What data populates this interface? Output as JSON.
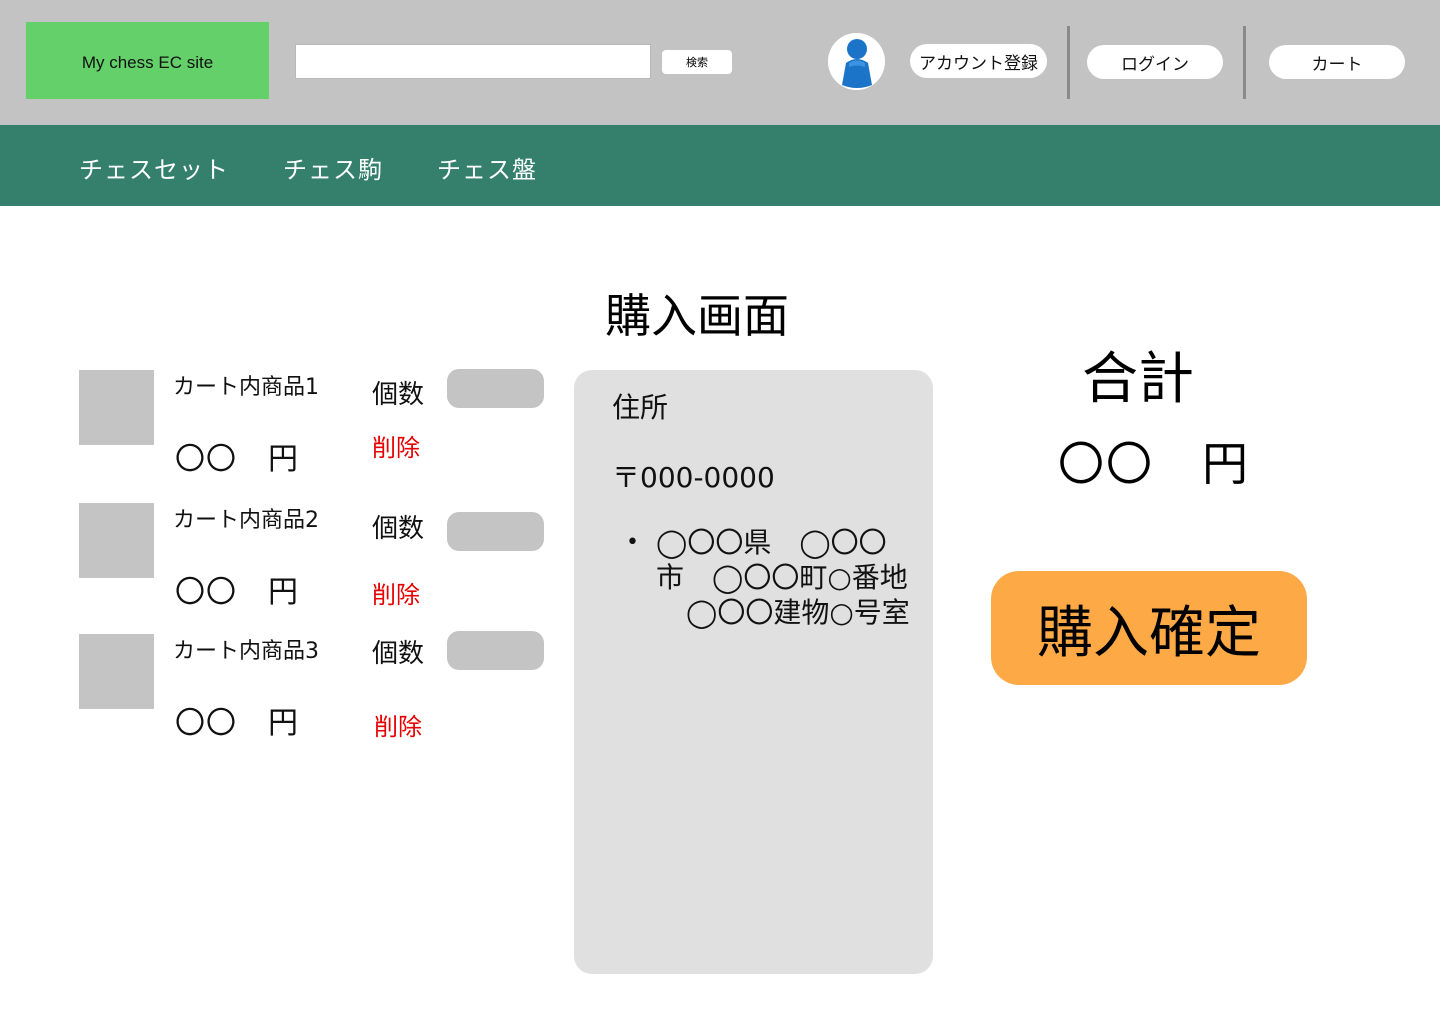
{
  "header": {
    "logo_text": "My chess EC site",
    "search": {
      "value": "",
      "button_label": "検索"
    },
    "account_register_label": "アカウント登録",
    "login_label": "ログイン",
    "cart_label": "カート"
  },
  "nav": {
    "items": [
      {
        "label": "チェスセット"
      },
      {
        "label": "チェス駒"
      },
      {
        "label": "チェス盤"
      }
    ]
  },
  "page": {
    "title": "購入画面"
  },
  "cart": {
    "qty_label": "個数",
    "delete_label": "削除",
    "items": [
      {
        "name": "カート内商品1",
        "price": "〇〇　円"
      },
      {
        "name": "カート内商品2",
        "price": "〇〇　円"
      },
      {
        "name": "カート内商品3",
        "price": "〇〇　円"
      }
    ]
  },
  "address": {
    "label": "住所",
    "postal": "〒000-0000",
    "bullet": "•",
    "lines": [
      "◯〇〇県　◯〇〇",
      "市　◯〇〇町○番地",
      "◯〇〇建物○号室"
    ]
  },
  "total": {
    "label": "合計",
    "value": "〇〇　円"
  },
  "confirm_button_label": "購入確定",
  "colors": {
    "header_bg": "#c3c3c3",
    "logo_bg": "#64d06a",
    "nav_bg": "#34806c",
    "delete_text": "#e60000",
    "confirm_bg": "#fda946",
    "address_bg": "#e0e0e0"
  }
}
